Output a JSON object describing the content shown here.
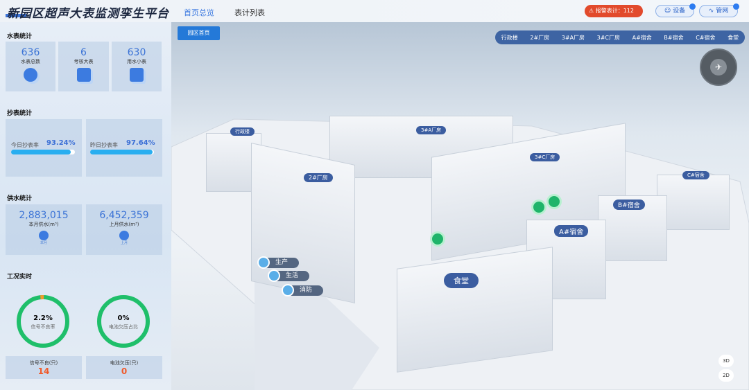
{
  "header": {
    "title": "新园区超声大表监测孪生平台",
    "nav": [
      "首页总览",
      "表计列表"
    ],
    "alarm": "报警表计：112",
    "device": "设备",
    "pipe": "管网"
  },
  "sidebar": {
    "meter_title": "水表统计",
    "meters": [
      {
        "value": "636",
        "label": "水表总数"
      },
      {
        "value": "6",
        "label": "考核大表"
      },
      {
        "value": "630",
        "label": "用水小表"
      }
    ],
    "read_title": "抄表统计",
    "reads": [
      {
        "label": "今日抄表率",
        "value": "93.24%",
        "pct": 93.24
      },
      {
        "label": "昨日抄表率",
        "value": "97.64%",
        "pct": 97.64
      }
    ],
    "supply_title": "供水统计",
    "supply": [
      {
        "value": "2,883,015",
        "label": "本月供水(m³)",
        "icon": "本月"
      },
      {
        "value": "6,452,359",
        "label": "上月供水(m³)",
        "icon": "上月"
      }
    ],
    "status_title": "工况实时",
    "gauges": [
      {
        "value": "2.2%",
        "label": "信号不良率",
        "pct": 2.2
      },
      {
        "value": "0%",
        "label": "电池欠压占比",
        "pct": 0
      }
    ],
    "counts": [
      {
        "label": "信号不良(只)",
        "value": "14"
      },
      {
        "label": "电池欠压(只)",
        "value": "0"
      }
    ]
  },
  "scene": {
    "home_button": "园区首页",
    "buildings_nav": [
      "行政楼",
      "2#厂房",
      "3#A厂房",
      "3#C厂房",
      "A#宿舍",
      "B#宿舍",
      "C#宿舍",
      "食堂"
    ],
    "labels": {
      "admin": "行政楼",
      "a3": "3#A厂房",
      "f2": "2#厂房",
      "c3": "3#C厂房",
      "cd": "C#宿舍",
      "bd": "B#宿舍",
      "ad": "A#宿舍",
      "canteen": "食堂"
    },
    "tags": [
      "生产",
      "生活",
      "消防"
    ],
    "view_3d": "3D",
    "view_2d": "2D",
    "colors": {
      "accent": "#2479d8",
      "alarm": "#e24a2c",
      "gauge_ok": "#1fbf6a",
      "gauge_bad": "#f39a2b"
    }
  }
}
